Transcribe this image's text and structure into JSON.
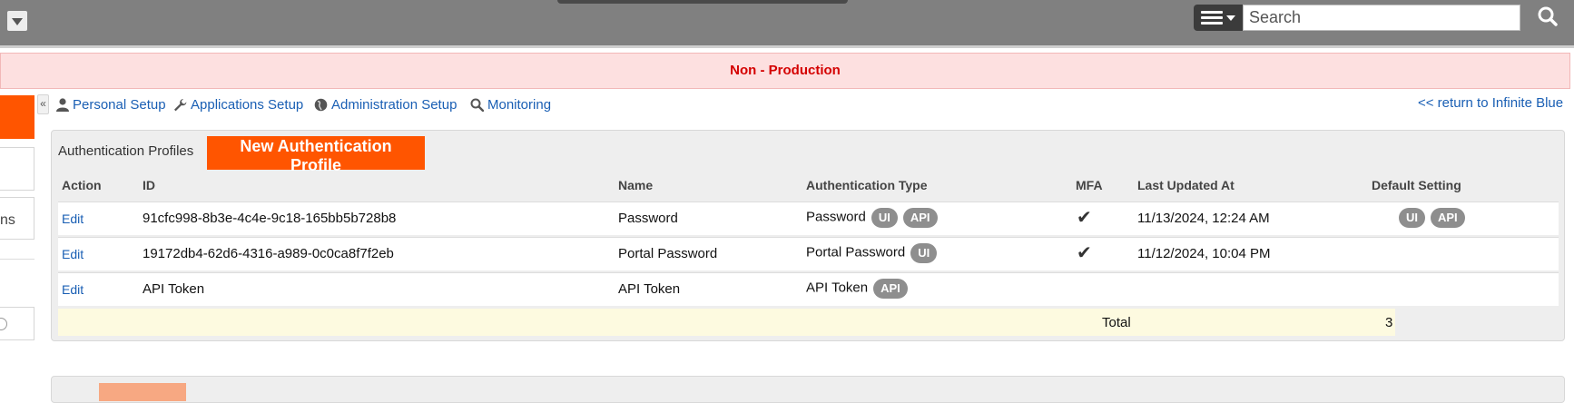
{
  "topbar": {
    "search_placeholder": "Search",
    "icons": {
      "dropdown": "chevron-down-icon",
      "menu": "hamburger-menu-icon",
      "search": "search-icon"
    }
  },
  "banner": {
    "text": "Non - Production",
    "color": "#d40000",
    "background": "#fde0e0"
  },
  "sidebar": {
    "partial_text": "ns",
    "collapse_glyph": "«",
    "accent_color": "#ff5500"
  },
  "nav": {
    "links": [
      {
        "label": "Personal Setup",
        "icon": "user-icon"
      },
      {
        "label": "Applications Setup",
        "icon": "wrench-icon"
      },
      {
        "label": "Administration Setup",
        "icon": "globe-icon"
      },
      {
        "label": "Monitoring",
        "icon": "search-icon"
      }
    ],
    "return_link": "<< return to Infinite Blue"
  },
  "panel": {
    "title": "Authentication Profiles",
    "new_button": "New Authentication Profile",
    "columns": [
      "Action",
      "ID",
      "Name",
      "Authentication Type",
      "MFA",
      "Last Updated At",
      "Default Setting"
    ],
    "rows": [
      {
        "action": "Edit",
        "id": "91cfc998-8b3e-4c4e-9c18-165bb5b728b8",
        "name": "Password",
        "auth_type": "Password",
        "auth_badges": [
          "UI",
          "API"
        ],
        "mfa": "✔",
        "updated": "11/13/2024, 12:24 AM",
        "default_badges": [
          "UI",
          "API"
        ]
      },
      {
        "action": "Edit",
        "id": "19172db4-62d6-4316-a989-0c0ca8f7f2eb",
        "name": "Portal Password",
        "auth_type": "Portal Password",
        "auth_badges": [
          "UI"
        ],
        "mfa": "✔",
        "updated": "11/12/2024, 10:04 PM",
        "default_badges": []
      },
      {
        "action": "Edit",
        "id": "API Token",
        "name": "API Token",
        "auth_type": "API Token",
        "auth_badges": [
          "API"
        ],
        "mfa": "",
        "updated": "",
        "default_badges": []
      }
    ],
    "total_label": "Total",
    "total_value": "3"
  }
}
